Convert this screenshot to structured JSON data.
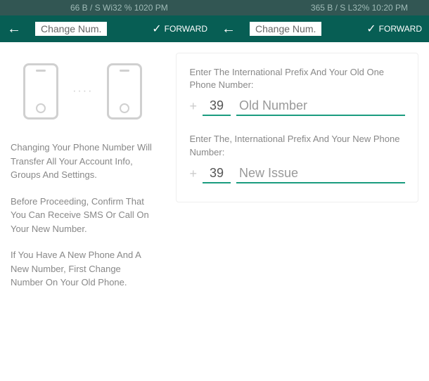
{
  "status_left": "66 B / S Wi32 % 1020 PM",
  "status_right": "365 B / S L32% 10:20 PM",
  "appbar": {
    "title_left": "Change Num.",
    "title_right": "Change Num.",
    "forward": "FORWARD"
  },
  "left_panel": {
    "dots": "····",
    "info1": "Changing Your Phone Number Will Transfer All Your Account Info, Groups And Settings.",
    "info2": "Before Proceeding, Confirm That You Can Receive SMS Or Call On Your New Number.",
    "info3": "If You Have A New Phone And A New Number, First Change Number On Your Old Phone."
  },
  "form": {
    "label_old": "Enter The International Prefix And Your Old One Phone Number:",
    "label_new": "Enter The, International Prefix And Your New Phone Number:",
    "plus": "+",
    "prefix_old": "39",
    "placeholder_old": "Old Number",
    "prefix_new": "39",
    "placeholder_new": "New Issue"
  }
}
